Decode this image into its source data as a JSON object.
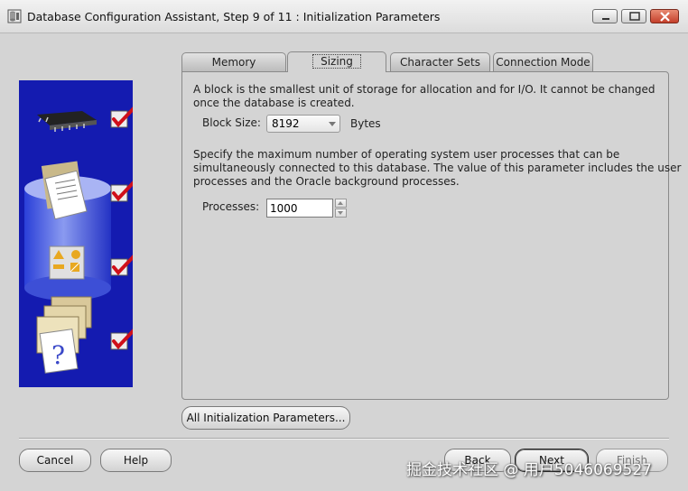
{
  "window": {
    "title": "Database Configuration Assistant, Step 9 of 11 : Initialization Parameters",
    "icons": [
      "database-app-icon",
      "minimize-icon",
      "maximize-icon",
      "close-icon"
    ]
  },
  "sidebar": {
    "icons": [
      "memory-chip-icon",
      "storage-documents-icon",
      "character-shapes-icon",
      "connection-help-icon"
    ],
    "checks": [
      "checked",
      "checked",
      "checked",
      "checked"
    ]
  },
  "tabs": [
    {
      "label": "Memory",
      "active": false
    },
    {
      "label": "Sizing",
      "active": true
    },
    {
      "label": "Character Sets",
      "active": false
    },
    {
      "label": "Connection Mode",
      "active": false
    }
  ],
  "sizing": {
    "block_desc_1": "A block is the smallest unit of storage for allocation and for I/O. It cannot be changed",
    "block_desc_2": "once the database is created.",
    "block_size_label": "Block Size:",
    "block_size_value": "8192",
    "block_size_unit": "Bytes",
    "proc_desc_1": "Specify the maximum number of operating system user processes that can be",
    "proc_desc_2": "simultaneously connected to this database. The value of this parameter includes the user",
    "proc_desc_3": "processes and the Oracle background processes.",
    "processes_label": "Processes:",
    "processes_value": "1000"
  },
  "buttons": {
    "all_params": "All Initialization Parameters...",
    "cancel": "Cancel",
    "help": "Help",
    "back": "Back",
    "next": "Next",
    "finish": "Finish"
  },
  "watermark": "掘金技术社区 @ 用户5046069527",
  "colors": {
    "sidebar_bg": "#141bb0",
    "check_red": "#d0101a",
    "close_button": "#c4402b"
  }
}
